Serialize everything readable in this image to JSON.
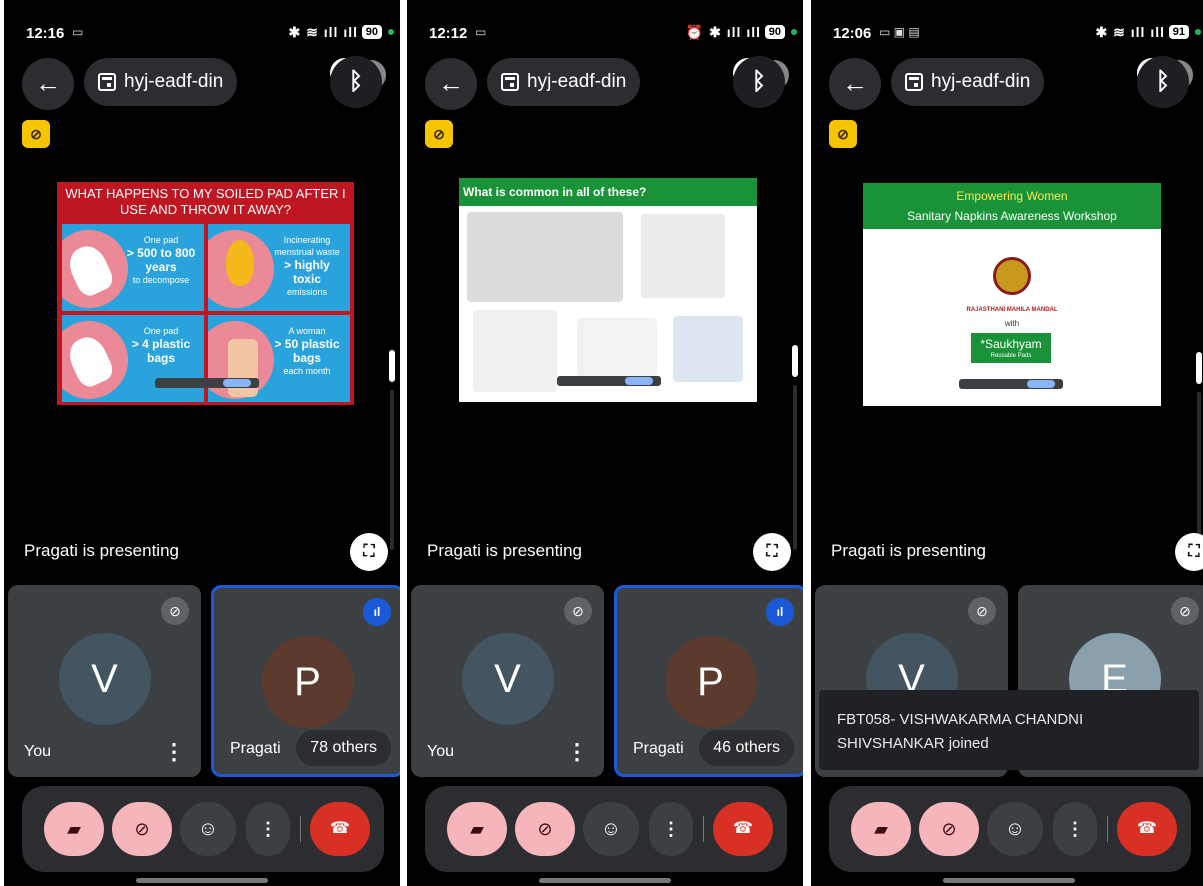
{
  "screens": [
    {
      "status": {
        "time": "12:16",
        "battery": "90",
        "network": "Vo LTE1 5G"
      },
      "meeting": {
        "code": "hyj-eadf-din"
      },
      "presenting_text": "Pragati is presenting",
      "slide": {
        "title": "WHAT HAPPENS TO MY SOILED PAD AFTER I USE AND THROW IT AWAY?",
        "cells": [
          {
            "small": "One pad",
            "big": "> 500 to 800 years",
            "tail": "to decompose"
          },
          {
            "small": "Incinerating menstrual waste",
            "big": "> highly toxic",
            "tail": "emissions"
          },
          {
            "small": "One pad",
            "big": "> 4 plastic bags",
            "tail": ""
          },
          {
            "small": "A woman",
            "big": "> 50 plastic bags",
            "tail": "each month"
          }
        ]
      },
      "tiles": {
        "left": {
          "initial": "V",
          "name": "You",
          "avatar_color": "#425560"
        },
        "right": {
          "initial": "P",
          "name": "Pragati",
          "others": "78 others",
          "avatar_color": "#5c3a2e"
        }
      }
    },
    {
      "status": {
        "time": "12:12",
        "battery": "90",
        "network": "Vo LTE1 5G"
      },
      "meeting": {
        "code": "hyj-eadf-din"
      },
      "presenting_text": "Pragati is presenting",
      "slide": {
        "title": "What is common in all of these?"
      },
      "tiles": {
        "left": {
          "initial": "V",
          "name": "You",
          "avatar_color": "#425560"
        },
        "right": {
          "initial": "P",
          "name": "Pragati",
          "others": "46 others",
          "avatar_color": "#5c3a2e"
        }
      }
    },
    {
      "status": {
        "time": "12:06",
        "battery": "91",
        "network": "Vo LTE1 5G"
      },
      "meeting": {
        "code": "hyj-eadf-din"
      },
      "presenting_text": "Pragati is presenting",
      "slide": {
        "title": "Empowering Women",
        "subtitle": "Sanitary Napkins Awareness Workshop",
        "org": "RAJASTHANI MAHILA MANDAL",
        "with": "with",
        "brand": "*Saukhyam",
        "brand_sub": "Reusable Pads"
      },
      "tiles": {
        "left": {
          "initial": "V",
          "avatar_color": "#425560"
        },
        "right": {
          "initial": "E",
          "avatar_color": "#8aa0ad"
        }
      },
      "toast": "FBT058- VISHWAKARMA CHANDNI SHIVSHANKAR joined"
    }
  ],
  "icons": {
    "back": "←",
    "bluetooth": "ᛒ",
    "fullscreen": "⛶",
    "mic_off": "🎙",
    "camera_off": "▬",
    "emoji": "☺",
    "more": "⋮",
    "hangup": "☎"
  },
  "colors": {
    "hangup": "#d93025",
    "muted_button": "#f5b5ba",
    "active_speaker": "#1a5ad8"
  }
}
